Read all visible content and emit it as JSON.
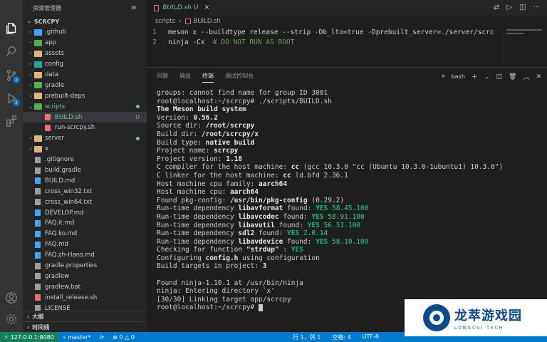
{
  "sidebar": {
    "header": "资源管理器",
    "root": "SCRCPY",
    "outline": "大纲",
    "timeline": "时间线",
    "items": [
      {
        "name": ".github",
        "type": "folder"
      },
      {
        "name": "app",
        "type": "folder"
      },
      {
        "name": "assets",
        "type": "folder"
      },
      {
        "name": "config",
        "type": "folder"
      },
      {
        "name": "data",
        "type": "folder"
      },
      {
        "name": "gradle",
        "type": "folder"
      },
      {
        "name": "prebuilt-deps",
        "type": "folder"
      },
      {
        "name": "scripts",
        "type": "folder-open"
      },
      {
        "name": "BUILD.sh",
        "type": "file",
        "flag": "U"
      },
      {
        "name": "run-scrcpy.sh",
        "type": "file"
      },
      {
        "name": "server",
        "type": "folder"
      },
      {
        "name": "x",
        "type": "folder"
      },
      {
        "name": ".gitignore",
        "type": "file"
      },
      {
        "name": "build.gradle",
        "type": "file"
      },
      {
        "name": "BUILD.md",
        "type": "file"
      },
      {
        "name": "cross_win32.txt",
        "type": "file"
      },
      {
        "name": "cross_win64.txt",
        "type": "file"
      },
      {
        "name": "DEVELOP.md",
        "type": "file"
      },
      {
        "name": "FAQ.it.md",
        "type": "file"
      },
      {
        "name": "FAQ.ko.md",
        "type": "file"
      },
      {
        "name": "FAQ.md",
        "type": "file"
      },
      {
        "name": "FAQ.zh-Hans.md",
        "type": "file"
      },
      {
        "name": "gradle.properties",
        "type": "file"
      },
      {
        "name": "gradlew",
        "type": "file"
      },
      {
        "name": "gradlew.bat",
        "type": "file"
      },
      {
        "name": "install_release.sh",
        "type": "file"
      },
      {
        "name": "LICENSE",
        "type": "file"
      }
    ]
  },
  "activity": {
    "scm_badge": "2",
    "run_badge": "1"
  },
  "editor": {
    "tab_label": "BUILD.sh",
    "tab_flag": "U",
    "breadcrumb_folder": "scripts",
    "breadcrumb_file": "BUILD.sh",
    "lines": [
      {
        "num": "1",
        "code": "meson x --buildtype release --strip -Db_lto=true -Dprebuilt_server=./server/scrc",
        "comment": ""
      },
      {
        "num": "2",
        "code": "ninja -Cx  ",
        "comment": "# DO NOT RUN AS ROOT"
      }
    ]
  },
  "panel": {
    "tabs": [
      "问题",
      "输出",
      "终端",
      "调试控制台"
    ],
    "active_tab": "终端",
    "shell": "bash"
  },
  "terminal": {
    "l01": "groups: cannot find name for group ID 3001",
    "l02": "root@localhost:~/scrcpy# ./scripts/BUILD.sh",
    "l03": "The Meson build system",
    "l04a": "Version: ",
    "l04b": "0.56.2",
    "l05a": "Source dir: ",
    "l05b": "/root/scrcpy",
    "l06a": "Build dir: ",
    "l06b": "/root/scrcpy/x",
    "l07a": "Build type: ",
    "l07b": "native build",
    "l08a": "Project name: ",
    "l08b": "scrcpy",
    "l09a": "Project version: ",
    "l09b": "1.18",
    "l10a": "C compiler for the host machine: ",
    "l10b": "cc",
    "l10c": " (gcc 10.3.0 \"cc (Ubuntu 10.3.0-1ubuntu1) 10.3.0\")",
    "l11a": "C linker for the host machine: ",
    "l11b": "cc",
    "l11c": " ld.bfd 2.36.1",
    "l12a": "Host machine cpu family: ",
    "l12b": "aarch64",
    "l13a": "Host machine cpu: ",
    "l13b": "aarch64",
    "l14a": "Found pkg-config: ",
    "l14b": "/usr/bin/pkg-config",
    "l14c": " (0.29.2)",
    "deps": [
      {
        "pre": "Run-time dependency ",
        "name": "libavformat",
        "mid": " found: ",
        "yes": "YES",
        "ver": " 58.45.100"
      },
      {
        "pre": "Run-time dependency ",
        "name": "libavcodec",
        "mid": " found: ",
        "yes": "YES",
        "ver": " 58.91.100"
      },
      {
        "pre": "Run-time dependency ",
        "name": "libavutil",
        "mid": " found: ",
        "yes": "YES",
        "ver": " 56.51.100"
      },
      {
        "pre": "Run-time dependency ",
        "name": "sdl2",
        "mid": " found: ",
        "yes": "YES",
        "ver": " 2.0.14"
      },
      {
        "pre": "Run-time dependency ",
        "name": "libavdevice",
        "mid": " found: ",
        "yes": "YES",
        "ver": " 58.10.100"
      }
    ],
    "l20a": "Checking for function ",
    "l20b": "\"strdup\"",
    "l20c": " : ",
    "l20d": "YES",
    "l21a": "Configuring ",
    "l21b": "config.h",
    "l21c": " using configuration",
    "l22a": "Build targets in project: ",
    "l22b": "3",
    "l24": "Found ninja-1.10.1 at /usr/bin/ninja",
    "l25": "ninja: Entering directory `x'",
    "l26": "[30/30] Linking target app/scrcpy",
    "l27": "root@localhost:~/scrcpy# "
  },
  "status": {
    "remote": "127.0.0.1:8080",
    "branch": "master*",
    "errors": "0",
    "warnings": "0",
    "position": "行 1，列 1",
    "spaces": "空格: 4",
    "encoding": "UTF-8"
  },
  "watermark": {
    "cn": "龙萃游戏园",
    "en": "LONGCUI TECH"
  }
}
